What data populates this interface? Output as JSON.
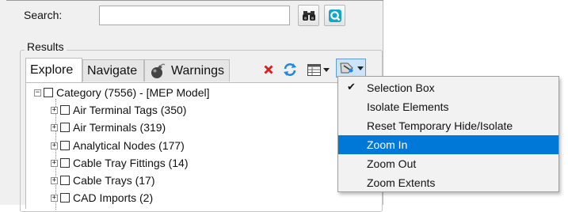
{
  "search": {
    "label": "Search:",
    "value": "",
    "placeholder": ""
  },
  "toolbar": {
    "find_icon": "binoculars-icon",
    "quick_icon": "q-search-icon"
  },
  "results": {
    "legend": "Results"
  },
  "tabs": [
    {
      "label": "Explore",
      "active": true
    },
    {
      "label": "Navigate",
      "active": false
    },
    {
      "label": "Warnings",
      "active": false,
      "icon": "bomb-icon"
    }
  ],
  "tree": {
    "root": {
      "label": "Category (7556) - [MEP Model]",
      "expander": "−"
    },
    "children": [
      {
        "label": "Air Terminal Tags (350)",
        "expander": "+"
      },
      {
        "label": "Air Terminals (319)",
        "expander": "+"
      },
      {
        "label": "Analytical Nodes (177)",
        "expander": "+"
      },
      {
        "label": "Cable Tray Fittings (14)",
        "expander": "+"
      },
      {
        "label": "Cable Trays (17)",
        "expander": "+"
      },
      {
        "label": "CAD Imports (2)",
        "expander": "+"
      }
    ]
  },
  "menu": {
    "items": [
      {
        "label": "Selection Box",
        "checked": true,
        "highlighted": false
      },
      {
        "label": "Isolate Elements",
        "checked": false,
        "highlighted": false
      },
      {
        "label": "Reset Temporary Hide/Isolate",
        "checked": false,
        "highlighted": false
      },
      {
        "label": "Zoom In",
        "checked": false,
        "highlighted": true
      },
      {
        "label": "Zoom Out",
        "checked": false,
        "highlighted": false
      },
      {
        "label": "Zoom Extents",
        "checked": false,
        "highlighted": false
      }
    ],
    "check_glyph": "✔"
  },
  "colors": {
    "highlight": "#0078d7",
    "accent_blue": "#1e88e5",
    "delete_red": "#d22222"
  }
}
